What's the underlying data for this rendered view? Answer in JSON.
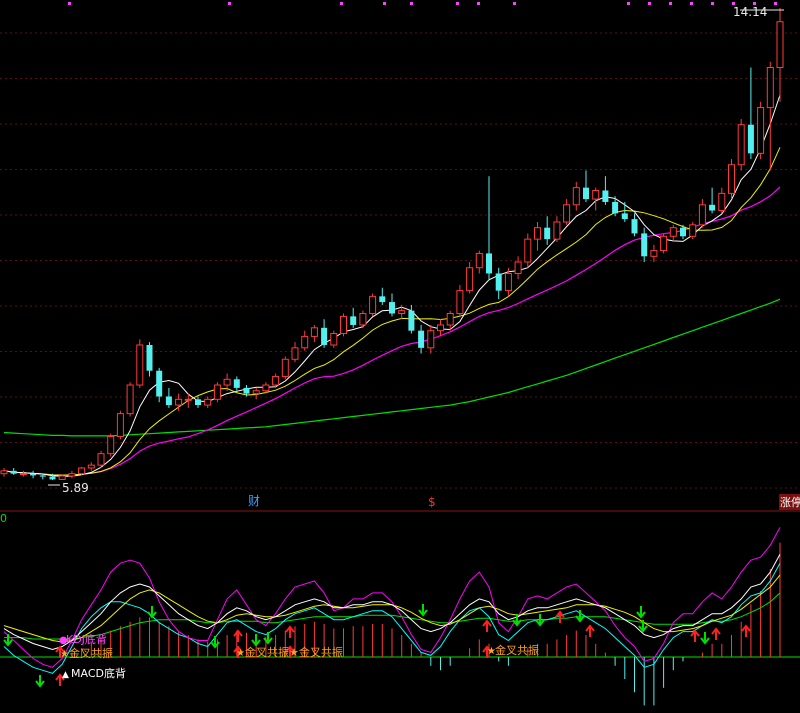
{
  "chart_data": [
    {
      "type": "candlestick",
      "title": "",
      "price_high_label": "14.14",
      "price_low_label": "5.89",
      "markers": {
        "fin": "财",
        "dollar": "$",
        "limit_up": "涨停"
      },
      "colors": {
        "up": "#ff3a3a",
        "down": "#54f0f0",
        "ma5": "#ffffff",
        "ma10": "#f0f000",
        "ma20": "#ff00ff",
        "ma60": "#00e000",
        "grid": "#5a1010"
      },
      "ohlc": [
        [
          6.0,
          6.1,
          5.95,
          6.05
        ],
        [
          6.05,
          6.1,
          5.98,
          6.0
        ],
        [
          6.0,
          6.05,
          5.95,
          6.0
        ],
        [
          6.0,
          6.05,
          5.92,
          5.97
        ],
        [
          5.97,
          6.0,
          5.9,
          5.95
        ],
        [
          5.95,
          6.0,
          5.89,
          5.9
        ],
        [
          5.9,
          5.98,
          5.89,
          5.96
        ],
        [
          5.96,
          6.05,
          5.92,
          6.0
        ],
        [
          6.0,
          6.12,
          5.98,
          6.1
        ],
        [
          6.1,
          6.2,
          6.05,
          6.15
        ],
        [
          6.15,
          6.4,
          6.1,
          6.35
        ],
        [
          6.35,
          6.7,
          6.3,
          6.65
        ],
        [
          6.65,
          7.1,
          6.6,
          7.05
        ],
        [
          7.05,
          7.6,
          7.0,
          7.55
        ],
        [
          7.55,
          8.35,
          7.5,
          8.25
        ],
        [
          8.25,
          8.3,
          7.7,
          7.8
        ],
        [
          7.8,
          7.85,
          7.25,
          7.35
        ],
        [
          7.35,
          7.5,
          7.15,
          7.2
        ],
        [
          7.2,
          7.4,
          7.1,
          7.3
        ],
        [
          7.3,
          7.4,
          7.15,
          7.3
        ],
        [
          7.3,
          7.35,
          7.15,
          7.2
        ],
        [
          7.2,
          7.35,
          7.15,
          7.3
        ],
        [
          7.3,
          7.6,
          7.25,
          7.55
        ],
        [
          7.55,
          7.75,
          7.45,
          7.65
        ],
        [
          7.65,
          7.7,
          7.45,
          7.5
        ],
        [
          7.5,
          7.55,
          7.35,
          7.4
        ],
        [
          7.4,
          7.5,
          7.3,
          7.45
        ],
        [
          7.45,
          7.6,
          7.4,
          7.55
        ],
        [
          7.55,
          7.75,
          7.5,
          7.7
        ],
        [
          7.7,
          8.05,
          7.65,
          8.0
        ],
        [
          8.0,
          8.3,
          7.95,
          8.2
        ],
        [
          8.2,
          8.5,
          8.15,
          8.4
        ],
        [
          8.4,
          8.6,
          8.3,
          8.55
        ],
        [
          8.55,
          8.7,
          8.2,
          8.25
        ],
        [
          8.25,
          8.5,
          8.2,
          8.45
        ],
        [
          8.45,
          8.8,
          8.4,
          8.75
        ],
        [
          8.75,
          8.9,
          8.55,
          8.6
        ],
        [
          8.6,
          8.85,
          8.55,
          8.8
        ],
        [
          8.8,
          9.15,
          8.75,
          9.1
        ],
        [
          9.1,
          9.25,
          8.95,
          9.0
        ],
        [
          9.0,
          9.15,
          8.75,
          8.8
        ],
        [
          8.8,
          8.95,
          8.7,
          8.85
        ],
        [
          8.85,
          8.95,
          8.45,
          8.5
        ],
        [
          8.5,
          8.6,
          8.1,
          8.2
        ],
        [
          8.2,
          8.6,
          8.1,
          8.5
        ],
        [
          8.5,
          8.7,
          8.4,
          8.6
        ],
        [
          8.6,
          8.85,
          8.5,
          8.8
        ],
        [
          8.8,
          9.3,
          8.75,
          9.2
        ],
        [
          9.2,
          9.7,
          9.15,
          9.6
        ],
        [
          9.6,
          9.9,
          9.5,
          9.85
        ],
        [
          9.85,
          11.2,
          9.4,
          9.5
        ],
        [
          9.5,
          9.6,
          9.05,
          9.2
        ],
        [
          9.2,
          9.6,
          9.1,
          9.5
        ],
        [
          9.5,
          9.8,
          9.4,
          9.7
        ],
        [
          9.7,
          10.2,
          9.6,
          10.1
        ],
        [
          10.1,
          10.4,
          9.9,
          10.3
        ],
        [
          10.3,
          10.5,
          10.0,
          10.1
        ],
        [
          10.1,
          10.5,
          10.05,
          10.4
        ],
        [
          10.4,
          10.8,
          10.35,
          10.7
        ],
        [
          10.7,
          11.1,
          10.6,
          11.0
        ],
        [
          11.0,
          11.3,
          10.75,
          10.8
        ],
        [
          10.8,
          11.0,
          10.6,
          10.95
        ],
        [
          10.95,
          11.2,
          10.7,
          10.75
        ],
        [
          10.75,
          10.85,
          10.5,
          10.55
        ],
        [
          10.55,
          10.75,
          10.4,
          10.45
        ],
        [
          10.45,
          10.55,
          10.15,
          10.2
        ],
        [
          10.2,
          10.3,
          9.7,
          9.8
        ],
        [
          9.8,
          10.0,
          9.7,
          9.9
        ],
        [
          9.9,
          10.2,
          9.85,
          10.15
        ],
        [
          10.15,
          10.35,
          10.05,
          10.3
        ],
        [
          10.3,
          10.35,
          10.1,
          10.15
        ],
        [
          10.15,
          10.4,
          10.1,
          10.35
        ],
        [
          10.35,
          10.8,
          10.3,
          10.7
        ],
        [
          10.7,
          11.0,
          10.55,
          10.6
        ],
        [
          10.6,
          11.0,
          10.55,
          10.9
        ],
        [
          10.9,
          11.5,
          10.8,
          11.4
        ],
        [
          11.4,
          12.2,
          11.3,
          12.1
        ],
        [
          12.1,
          13.1,
          11.5,
          11.6
        ],
        [
          11.6,
          12.5,
          11.5,
          12.4
        ],
        [
          12.4,
          13.2,
          11.3,
          13.1
        ],
        [
          13.1,
          14.14,
          12.5,
          13.9
        ]
      ],
      "ma60": [
        6.72,
        6.71,
        6.7,
        6.69,
        6.68,
        6.67,
        6.67,
        6.66,
        6.66,
        6.66,
        6.66,
        6.66,
        6.67,
        6.68,
        6.69,
        6.7,
        6.71,
        6.72,
        6.73,
        6.74,
        6.75,
        6.76,
        6.77,
        6.78,
        6.79,
        6.8,
        6.81,
        6.82,
        6.84,
        6.86,
        6.88,
        6.9,
        6.92,
        6.94,
        6.96,
        6.98,
        7.0,
        7.02,
        7.04,
        7.06,
        7.08,
        7.1,
        7.12,
        7.14,
        7.16,
        7.18,
        7.2,
        7.23,
        7.26,
        7.3,
        7.34,
        7.38,
        7.42,
        7.47,
        7.52,
        7.57,
        7.62,
        7.67,
        7.72,
        7.78,
        7.84,
        7.9,
        7.96,
        8.02,
        8.08,
        8.14,
        8.2,
        8.26,
        8.32,
        8.38,
        8.44,
        8.5,
        8.56,
        8.62,
        8.68,
        8.74,
        8.8,
        8.86,
        8.92,
        8.98,
        9.05
      ]
    },
    {
      "type": "indicator",
      "top_label": "0",
      "signal_labels": {
        "kdj_div": "KDJ底背",
        "macd_div": "MACD底背",
        "golden_cross": "金叉共振",
        "golden_cross_double": "金叉共振★金叉共振"
      },
      "colors": {
        "k": "#ffffff",
        "d": "#f0f000",
        "j": "#ff00ff",
        "rsi": "#00ffff",
        "ref": "#00e000",
        "bar_pos": "#ff3a3a",
        "bar_neg": "#54f0f0",
        "label": "#ffa020",
        "up_arrow": "#ff2020",
        "down_arrow": "#00e000"
      },
      "k": [
        52,
        48,
        45,
        42,
        40,
        38,
        40,
        44,
        50,
        56,
        62,
        70,
        76,
        80,
        82,
        80,
        74,
        68,
        62,
        58,
        54,
        52,
        56,
        62,
        66,
        64,
        60,
        58,
        60,
        64,
        68,
        70,
        72,
        70,
        66,
        66,
        68,
        68,
        70,
        70,
        68,
        64,
        58,
        52,
        50,
        52,
        56,
        62,
        68,
        72,
        70,
        62,
        58,
        60,
        64,
        66,
        66,
        68,
        70,
        72,
        70,
        68,
        66,
        62,
        58,
        54,
        48,
        46,
        48,
        52,
        54,
        54,
        58,
        62,
        62,
        66,
        72,
        80,
        82,
        90,
        102
      ],
      "d": [
        54,
        52,
        50,
        48,
        46,
        44,
        43,
        44,
        46,
        50,
        54,
        60,
        66,
        72,
        76,
        78,
        76,
        72,
        68,
        64,
        60,
        57,
        56,
        58,
        61,
        62,
        61,
        60,
        60,
        61,
        63,
        65,
        67,
        68,
        67,
        66,
        66,
        67,
        68,
        68,
        68,
        66,
        63,
        59,
        56,
        54,
        55,
        58,
        62,
        66,
        67,
        65,
        62,
        61,
        62,
        63,
        64,
        65,
        66,
        68,
        68,
        68,
        67,
        65,
        63,
        60,
        56,
        52,
        50,
        50,
        51,
        52,
        54,
        57,
        59,
        61,
        65,
        70,
        75,
        80,
        88
      ],
      "j": [
        50,
        44,
        38,
        32,
        28,
        26,
        32,
        44,
        58,
        68,
        78,
        90,
        96,
        98,
        96,
        86,
        70,
        58,
        50,
        46,
        44,
        44,
        58,
        72,
        78,
        68,
        58,
        54,
        62,
        72,
        80,
        82,
        84,
        76,
        64,
        66,
        72,
        72,
        76,
        76,
        70,
        60,
        48,
        38,
        36,
        46,
        58,
        72,
        84,
        90,
        80,
        56,
        50,
        60,
        72,
        74,
        72,
        76,
        80,
        82,
        76,
        70,
        64,
        54,
        46,
        40,
        30,
        32,
        42,
        56,
        62,
        62,
        70,
        76,
        72,
        80,
        90,
        98,
        100,
        108,
        120
      ],
      "rsi": [
        40,
        34,
        30,
        26,
        24,
        22,
        28,
        40,
        52,
        60,
        66,
        70,
        70,
        68,
        66,
        62,
        56,
        52,
        48,
        46,
        42,
        40,
        48,
        56,
        58,
        54,
        50,
        48,
        52,
        58,
        62,
        64,
        66,
        62,
        58,
        58,
        60,
        62,
        64,
        64,
        60,
        52,
        44,
        36,
        34,
        40,
        50,
        58,
        64,
        66,
        60,
        48,
        44,
        50,
        56,
        58,
        58,
        60,
        62,
        64,
        60,
        56,
        52,
        46,
        40,
        34,
        26,
        28,
        38,
        46,
        50,
        50,
        54,
        58,
        56,
        60,
        68,
        74,
        76,
        84,
        96
      ],
      "ref": [
        46,
        46,
        46,
        45,
        45,
        45,
        45,
        45,
        46,
        47,
        48,
        50,
        52,
        54,
        56,
        57,
        58,
        58,
        58,
        58,
        57,
        56,
        56,
        57,
        57,
        57,
        57,
        56,
        56,
        57,
        58,
        59,
        60,
        60,
        60,
        60,
        60,
        61,
        61,
        61,
        61,
        60,
        59,
        58,
        57,
        56,
        56,
        57,
        58,
        59,
        59,
        58,
        57,
        57,
        58,
        58,
        58,
        59,
        59,
        60,
        60,
        60,
        60,
        59,
        58,
        57,
        56,
        55,
        55,
        55,
        55,
        55,
        56,
        57,
        57,
        58,
        60,
        63,
        66,
        70,
        76
      ],
      "bars": [
        0,
        0,
        0,
        0,
        0,
        0,
        1,
        2,
        4,
        6,
        9,
        12,
        14,
        16,
        18,
        18,
        16,
        14,
        12,
        10,
        8,
        7,
        8,
        10,
        12,
        11,
        10,
        9,
        10,
        12,
        14,
        15,
        16,
        15,
        13,
        13,
        14,
        14,
        15,
        15,
        13,
        10,
        6,
        2,
        -4,
        -6,
        -4,
        0,
        4,
        8,
        6,
        -2,
        -4,
        0,
        4,
        6,
        6,
        8,
        10,
        12,
        10,
        6,
        2,
        -4,
        -10,
        -16,
        -22,
        -22,
        -14,
        -6,
        -2,
        0,
        2,
        6,
        6,
        10,
        16,
        24,
        30,
        40,
        52
      ],
      "up_arrows": [
        9,
        36,
        37,
        44,
        45,
        58,
        67,
        72,
        73,
        82,
        83,
        84,
        88,
        91
      ],
      "down_arrows": [
        0,
        5,
        25,
        39,
        40,
        41,
        49,
        62,
        63,
        64,
        67,
        81,
        84,
        88
      ]
    }
  ]
}
